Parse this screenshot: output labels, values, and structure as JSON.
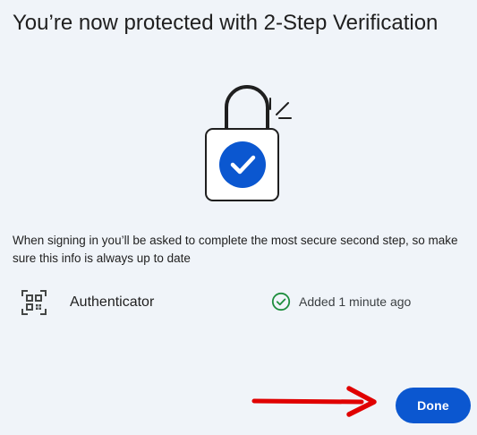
{
  "title": "You’re now protected with 2-Step Verification",
  "description": "When signing in you’ll be asked to complete the most secure second step, so make sure this info is always up to date",
  "methods": [
    {
      "icon": "qr-code-icon",
      "name": "Authenticator",
      "status_icon": "check-circle-icon",
      "status": "Added 1 minute ago"
    }
  ],
  "actions": {
    "done_label": "Done"
  },
  "colors": {
    "background": "#f0f4f9",
    "primary": "#0b57d0",
    "success": "#1e8e3e",
    "annotation_arrow": "#e00000"
  }
}
